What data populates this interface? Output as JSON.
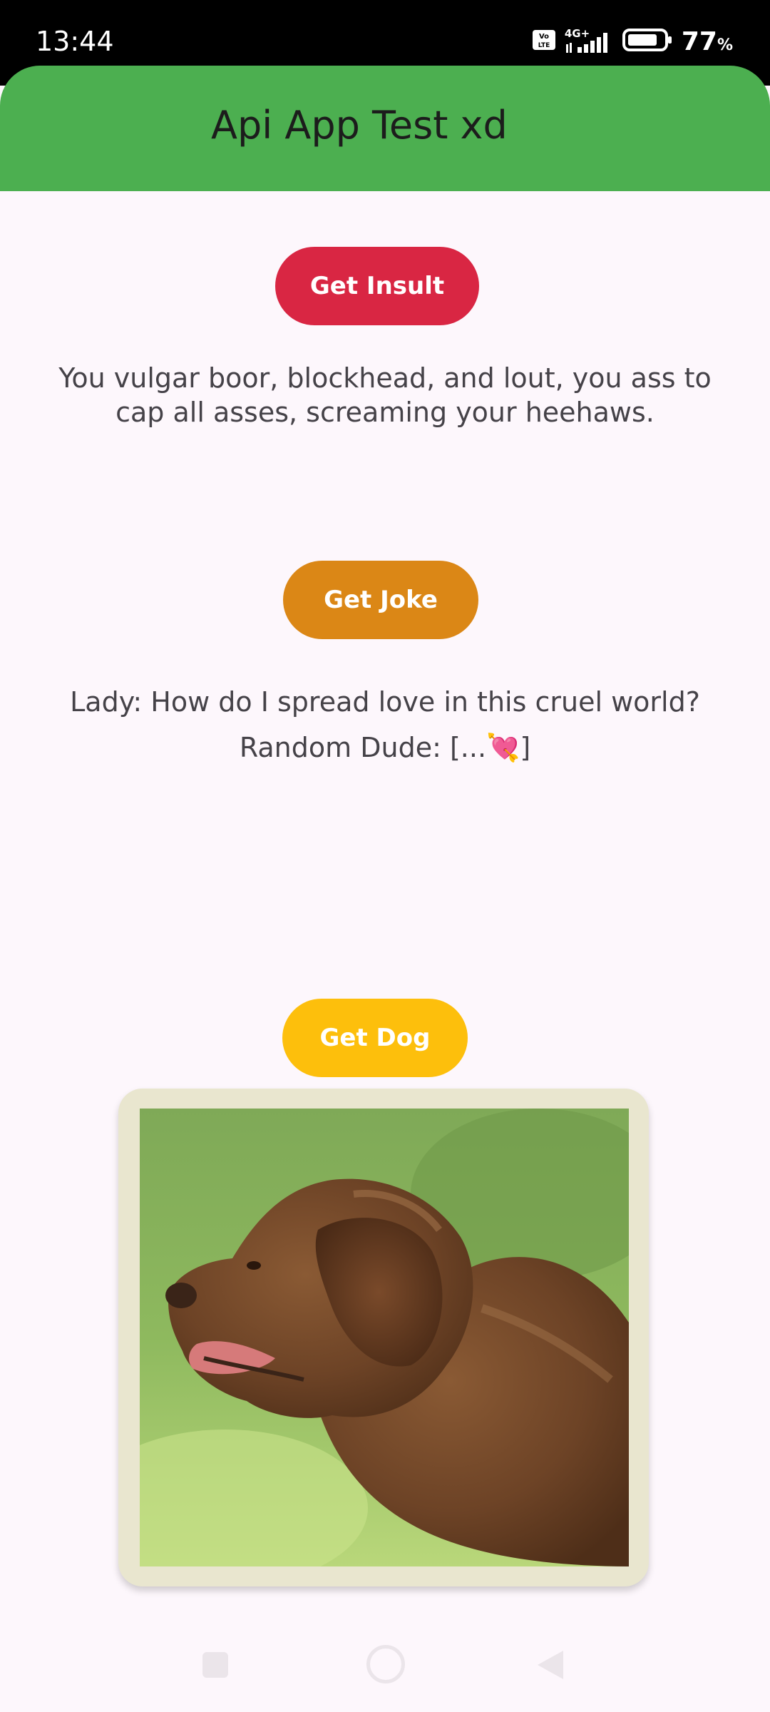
{
  "status_bar": {
    "time": "13:44",
    "network": "4G+",
    "battery_level": "77",
    "battery_unit": "%"
  },
  "app_bar": {
    "title": "Api App Test xd"
  },
  "insult": {
    "button_label": "Get Insult",
    "text": "You vulgar boor, blockhead, and lout, you ass to cap all asses, screaming your heehaws."
  },
  "joke": {
    "button_label": "Get Joke",
    "line1": "Lady: How do I spread love in this cruel world?",
    "line2": "Random Dude: [...💘]"
  },
  "dog": {
    "button_label": "Get Dog"
  },
  "colors": {
    "app_bar": "#4caf50",
    "insult_button": "#d92643",
    "joke_button": "#db8716",
    "dog_button": "#fdbf0c",
    "card_bg": "#e9e6cf",
    "page_bg": "#fdf7fc"
  },
  "icons": {
    "signal": "signal-icon",
    "volte": "volte-icon",
    "battery": "battery-icon",
    "nav_recents": "recents-square-icon",
    "nav_home": "home-circle-icon",
    "nav_back": "back-triangle-icon"
  }
}
